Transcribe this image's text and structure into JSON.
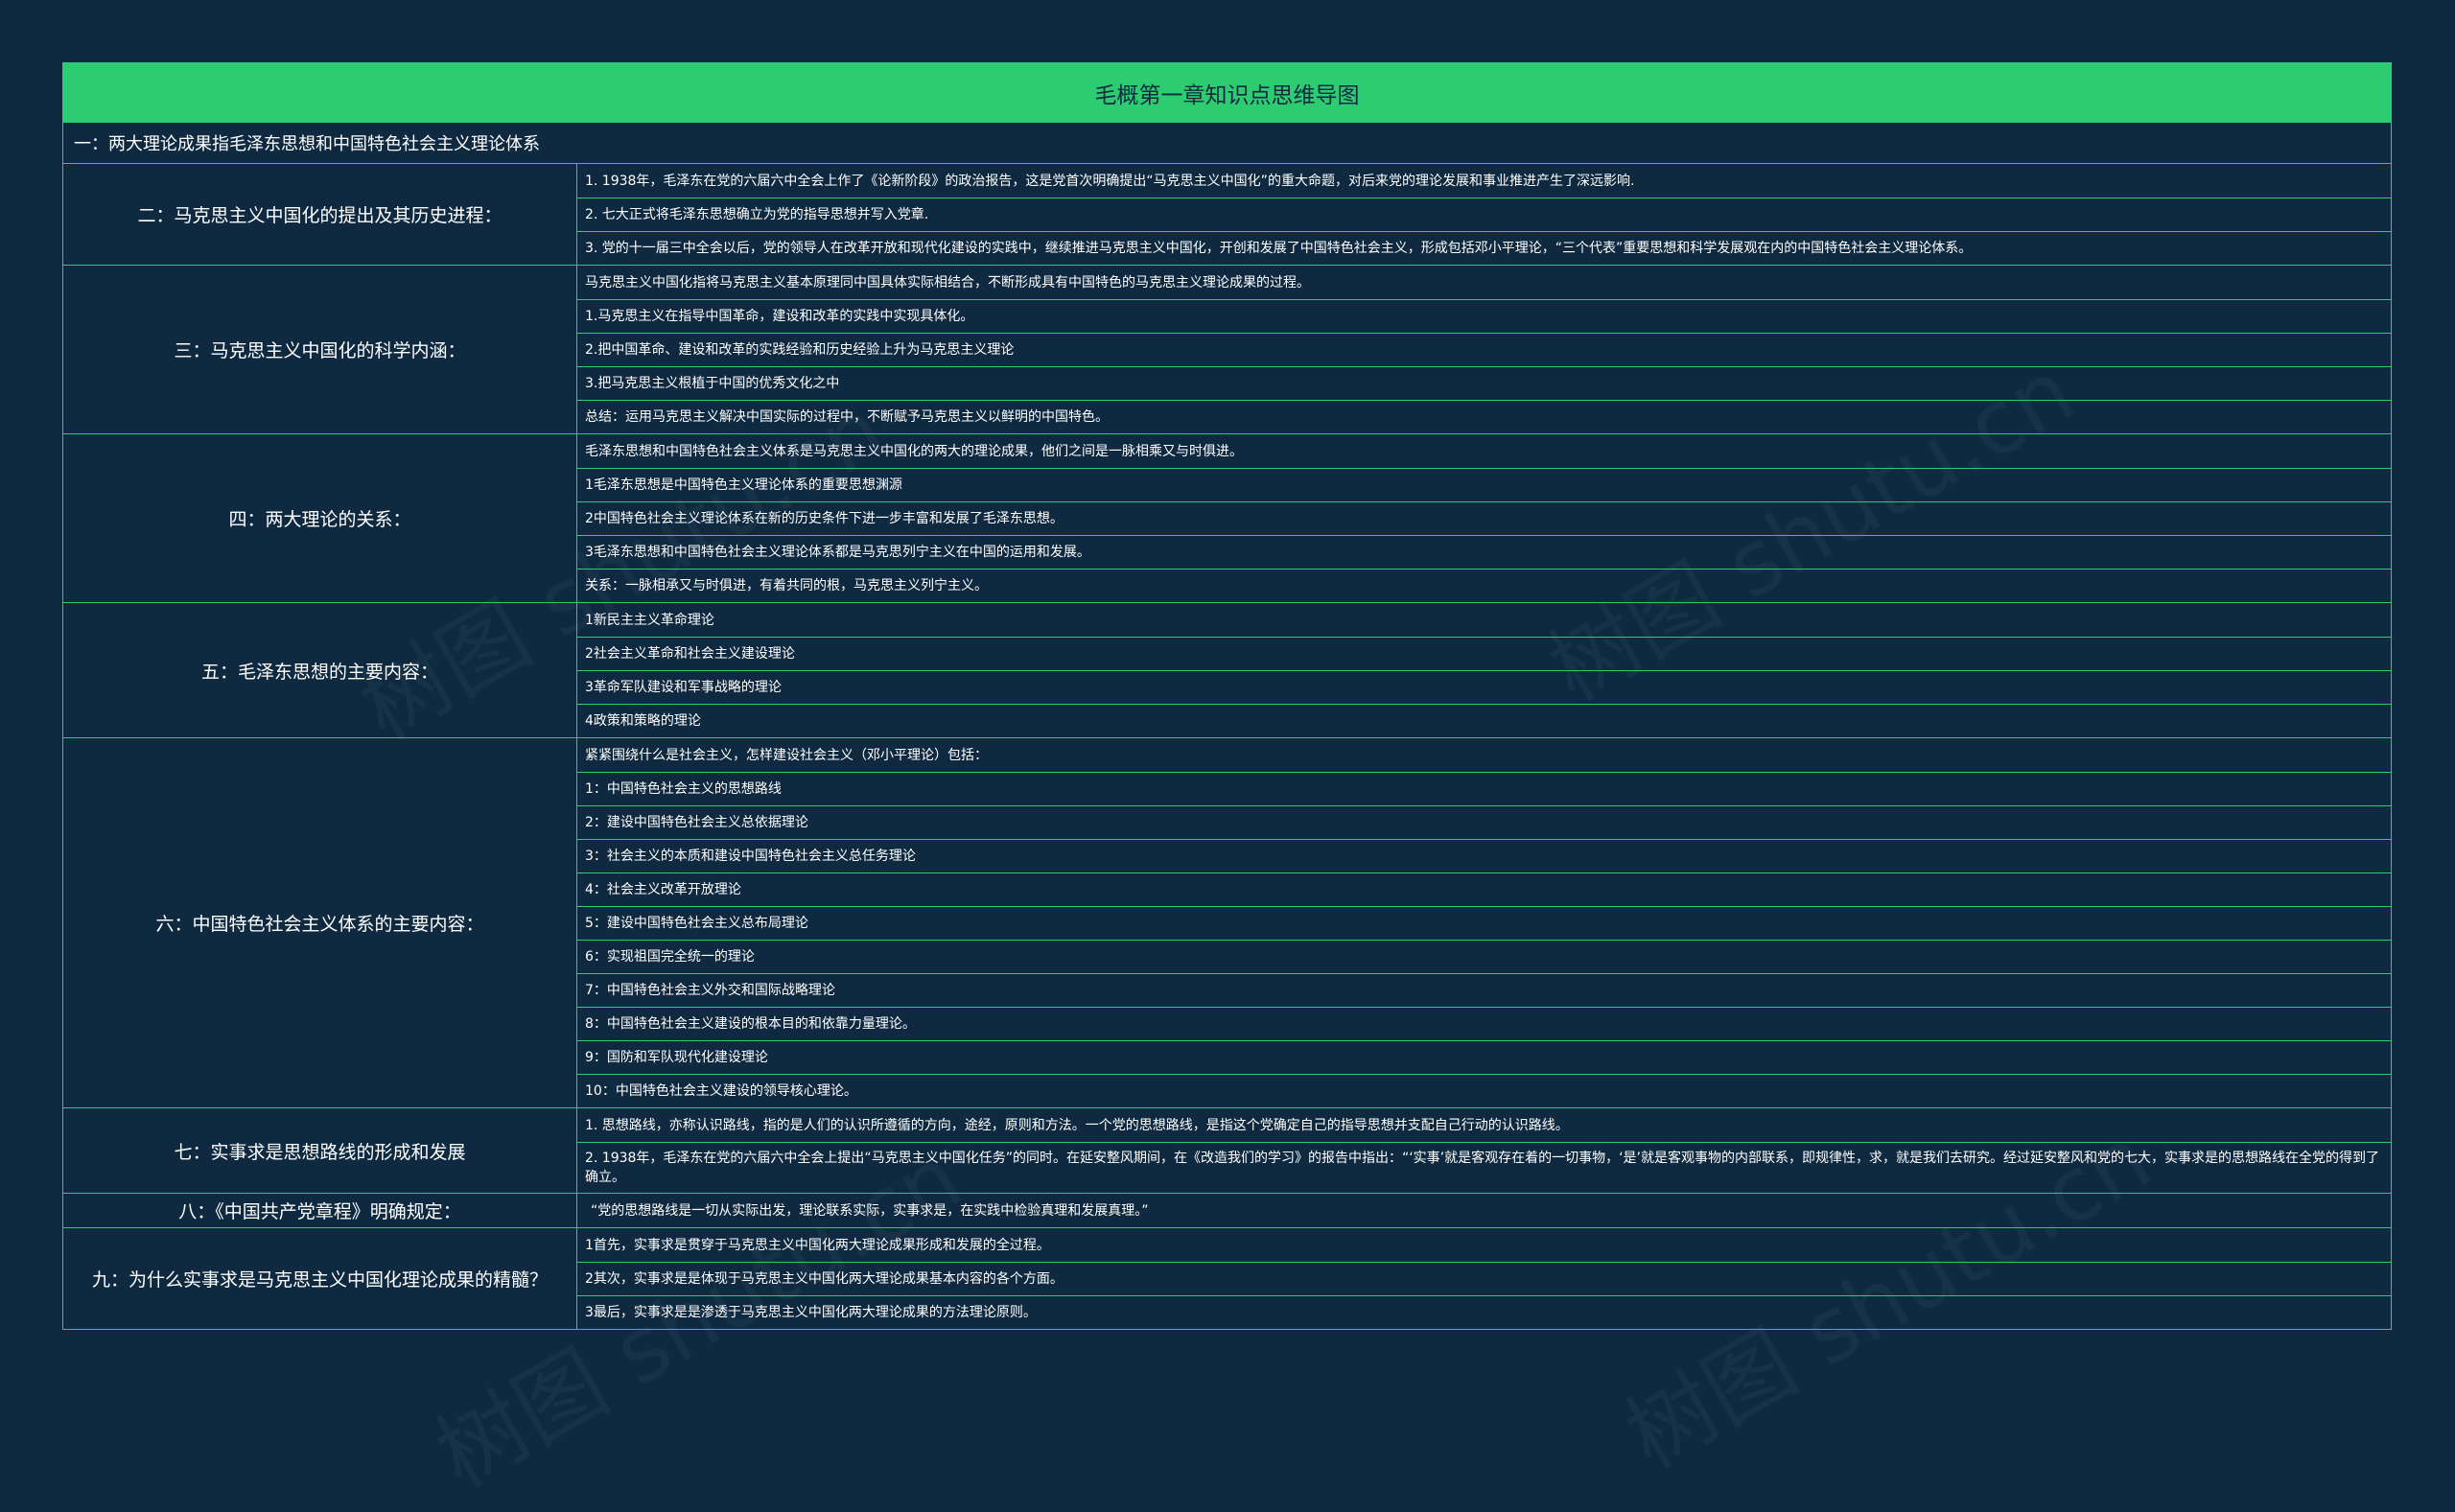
{
  "title": "毛概第一章知识点思维导图",
  "banner": "一：两大理论成果指毛泽东思想和中国特色社会主义理论体系",
  "watermark": "树图 shutu.cn",
  "colors": {
    "background": "#0f2a40",
    "accent": "#2ecc71",
    "title_text": "#102a40",
    "text": "#ffffff"
  },
  "sections": [
    {
      "label": "二：马克思主义中国化的提出及其历史进程：",
      "items": [
        "1. 1938年，毛泽东在党的六届六中全会上作了《论新阶段》的政治报告，这是党首次明确提出“马克思主义中国化”的重大命题，对后来党的理论发展和事业推进产生了深远影响.",
        "2. 七大正式将毛泽东思想确立为党的指导思想并写入党章.",
        "3. 党的十一届三中全会以后，党的领导人在改革开放和现代化建设的实践中，继续推进马克思主义中国化，开创和发展了中国特色社会主义，形成包括邓小平理论，“三个代表”重要思想和科学发展观在内的中国特色社会主义理论体系。"
      ]
    },
    {
      "label": "三：马克思主义中国化的科学内涵：",
      "items": [
        "马克思主义中国化指将马克思主义基本原理同中国具体实际相结合，不断形成具有中国特色的马克思主义理论成果的过程。",
        "1.马克思主义在指导中国革命，建设和改革的实践中实现具体化。",
        "2.把中国革命、建设和改革的实践经验和历史经验上升为马克思主义理论",
        "3.把马克思主义根植于中国的优秀文化之中",
        "总结：运用马克思主义解决中国实际的过程中，不断赋予马克思主义以鲜明的中国特色。"
      ]
    },
    {
      "label": "四：两大理论的关系：",
      "items": [
        "毛泽东思想和中国特色社会主义体系是马克思主义中国化的两大的理论成果，他们之间是一脉相乘又与时俱进。",
        "1毛泽东思想是中国特色主义理论体系的重要思想渊源",
        "2中国特色社会主义理论体系在新的历史条件下进一步丰富和发展了毛泽东思想。",
        "3毛泽东思想和中国特色社会主义理论体系都是马克思列宁主义在中国的运用和发展。",
        "关系：一脉相承又与时俱进，有着共同的根，马克思主义列宁主义。"
      ]
    },
    {
      "label": "五：毛泽东思想的主要内容：",
      "items": [
        "1新民主主义革命理论",
        "2社会主义革命和社会主义建设理论",
        "3革命军队建设和军事战略的理论",
        "4政策和策略的理论"
      ]
    },
    {
      "label": "六：中国特色社会主义体系的主要内容：",
      "items": [
        "紧紧围绕什么是社会主义，怎样建设社会主义（邓小平理论）包括：",
        "1：中国特色社会主义的思想路线",
        "2：建设中国特色社会主义总依据理论",
        "3：社会主义的本质和建设中国特色社会主义总任务理论",
        "4：社会主义改革开放理论",
        "5：建设中国特色社会主义总布局理论",
        "6：实现祖国完全统一的理论",
        "7：中国特色社会主义外交和国际战略理论",
        "8：中国特色社会主义建设的根本目的和依靠力量理论。",
        "9：国防和军队现代化建设理论",
        "10：中国特色社会主义建设的领导核心理论。"
      ]
    },
    {
      "label": "七：实事求是思想路线的形成和发展",
      "items": [
        "1. 思想路线，亦称认识路线，指的是人们的认识所遵循的方向，途经，原则和方法。一个党的思想路线，是指这个党确定自己的指导思想并支配自己行动的认识路线。",
        "2. 1938年，毛泽东在党的六届六中全会上提出“马克思主义中国化任务”的同时。在延安整风期间，在《改造我们的学习》的报告中指出：“‘实事’就是客观存在着的一切事物，‘是’就是客观事物的内部联系，即规律性，求，就是我们去研究。经过延安整风和党的七大，实事求是的思想路线在全党的得到了确立。"
      ]
    },
    {
      "label": "八：《中国共产党章程》明确规定：",
      "items": [
        "“党的思想路线是一切从实际出发，理论联系实际，实事求是，在实践中检验真理和发展真理。”"
      ]
    },
    {
      "label": "九：为什么实事求是马克思主义中国化理论成果的精髓？",
      "items": [
        "1首先，实事求是贯穿于马克思主义中国化两大理论成果形成和发展的全过程。",
        "2其次，实事求是是体现于马克思主义中国化两大理论成果基本内容的各个方面。",
        "3最后，实事求是是渗透于马克思主义中国化两大理论成果的方法理论原则。"
      ]
    }
  ]
}
